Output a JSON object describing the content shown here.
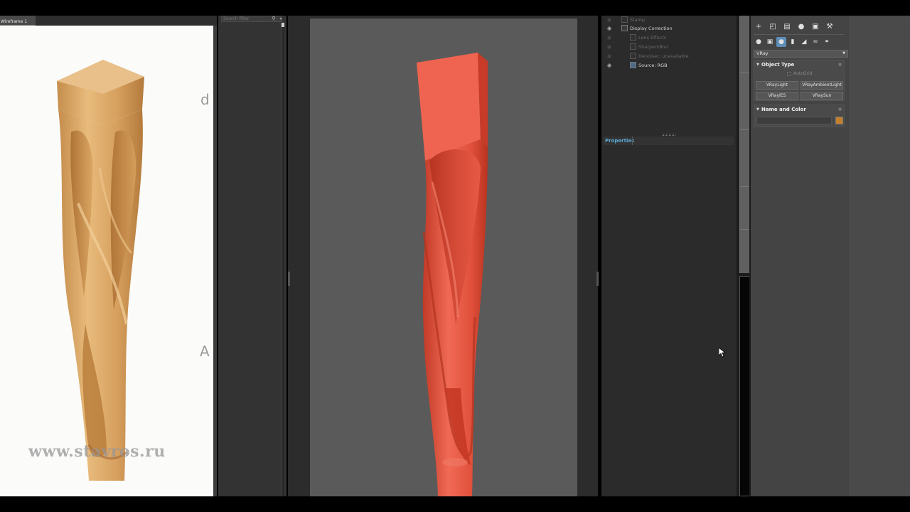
{
  "reference_panel": {
    "tab_label": "Wireframe 1",
    "letter_top": "d",
    "letter_bottom": "A",
    "watermark": "www.stavros.ru"
  },
  "filter_panel": {
    "search_placeholder": "Search filter"
  },
  "layers": {
    "items": [
      {
        "label": "Stamp",
        "visible": false,
        "indent": 0
      },
      {
        "label": "Display Correction",
        "visible": true,
        "indent": 0
      },
      {
        "label": "Lens Effects",
        "visible": false,
        "indent": 1
      },
      {
        "label": "Sharpen/Blur",
        "visible": false,
        "indent": 1
      },
      {
        "label": "Denoiser: unavailable",
        "visible": false,
        "indent": 1
      },
      {
        "label": "Source: RGB",
        "visible": true,
        "indent": 1
      }
    ],
    "properties_tab": "Properties"
  },
  "command_panel": {
    "tab_icons": [
      "create-icon",
      "modify-icon",
      "hierarchy-icon",
      "motion-icon",
      "display-icon",
      "utilities-icon"
    ],
    "category_icons": [
      "geometry-icon",
      "shapes-icon",
      "lights-icon",
      "cameras-icon",
      "helpers-icon",
      "space-warps-icon",
      "systems-icon"
    ],
    "category_dropdown": "VRay",
    "object_type": {
      "title": "Object Type",
      "autogrid": "AutoGrid",
      "buttons": [
        "VRayLight",
        "VRayAmbientLight",
        "VRayIES",
        "VRaySun"
      ]
    },
    "name_and_color": {
      "title": "Name and Color",
      "name_value": "",
      "color": "#c57f2b"
    }
  },
  "colors": {
    "render_object": "#e4533f",
    "render_background": "#5a5a5a",
    "wood": "#d8a563",
    "accent_blue": "#5aa8d6"
  }
}
